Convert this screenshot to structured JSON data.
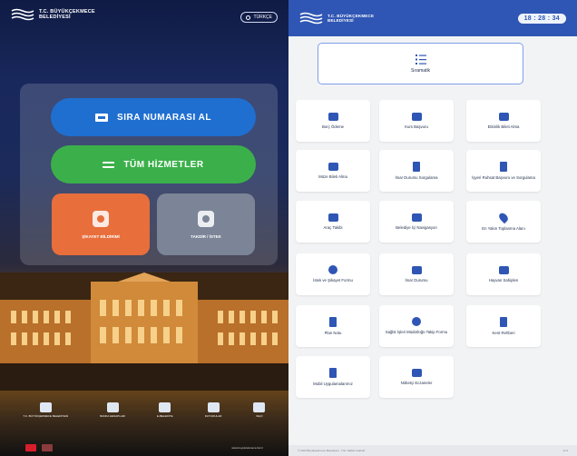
{
  "brand": {
    "line1": "T.C. BÜYÜKÇEKMECE",
    "line2": "BELEDİYESİ",
    "color": "#2f56b4"
  },
  "left_screen": {
    "language_button": "TÜRKÇE",
    "primary_buttons": [
      {
        "label": "SIRA NUMARASI AL",
        "icon": "ticket-icon",
        "color": "#1f6fd0"
      },
      {
        "label": "TÜM HİZMETLER",
        "icon": "list-icon",
        "color": "#3bb04a"
      }
    ],
    "tiles": [
      {
        "label": "ŞİKAYET BİLDİRİMİ",
        "icon": "chat-icon",
        "color": "#e86e3c"
      },
      {
        "label": "TAKDİR / İSTEK",
        "icon": "star-icon",
        "color": "#7c8597"
      }
    ],
    "footer_links": [
      {
        "label": "T.C. BÜYÜKÇEKMECE BELEDİYESİ",
        "icon": "logo-icon"
      },
      {
        "label": "BANKA HESAPLARI",
        "icon": "bank-icon"
      },
      {
        "label": "E-BELEDİYE",
        "icon": "web-icon"
      },
      {
        "label": "DUYURULAR",
        "icon": "megaphone-icon"
      },
      {
        "label": "KEÇİ",
        "icon": "info-icon"
      }
    ],
    "flags": [
      "TR",
      "EN"
    ],
    "copyright": "www.buyukcekmece.bel.tr"
  },
  "right_screen": {
    "clock": "18 : 28 : 34",
    "top_card": {
      "label": "Sıramatik",
      "icon": "list-icon"
    },
    "services": [
      {
        "label": "Borç Ödeme",
        "icon": "card-icon"
      },
      {
        "label": "Kurs Başvuru",
        "icon": "presentation-icon"
      },
      {
        "label": "Etkinlik Bileti Alma",
        "icon": "ticket-icon"
      },
      {
        "label": "Müze Bileti Alma",
        "icon": "ticket-icon"
      },
      {
        "label": "İmar Durumu Sorgulama",
        "icon": "document-icon"
      },
      {
        "label": "İşyeri Ruhsat Başvuru ve Sorgulama",
        "icon": "document-icon"
      },
      {
        "label": "Araç Takibi",
        "icon": "car-icon"
      },
      {
        "label": "Belediye İçi Navigasyon",
        "icon": "map-icon"
      },
      {
        "label": "En Yakın Toplanma Alanı",
        "icon": "pin-icon"
      },
      {
        "label": "İstek ve Şikayet Formu",
        "icon": "chat-icon"
      },
      {
        "label": "İmar Durumu",
        "icon": "building-icon"
      },
      {
        "label": "Hayvan Sahiplen",
        "icon": "paw-icon"
      },
      {
        "label": "Plan Notu",
        "icon": "clipboard-icon"
      },
      {
        "label": "Sağlık İşleri Müdürlüğü Takip Formu",
        "icon": "heart-icon"
      },
      {
        "label": "Kent Rehberi",
        "icon": "book-icon"
      },
      {
        "label": "Mobil Uygulamalarımız",
        "icon": "phone-icon"
      },
      {
        "label": "Nöbetçi Eczaneler",
        "icon": "pharmacy-icon"
      }
    ],
    "footer_left": "© 2024 Büyükçekmece Belediyesi · Tüm hakları saklıdır.",
    "footer_right": "v1.0"
  }
}
